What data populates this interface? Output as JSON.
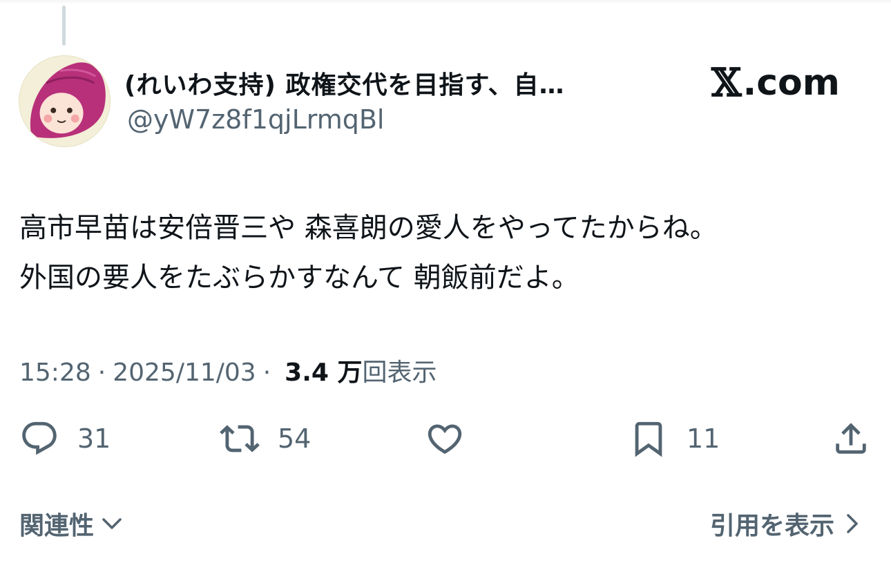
{
  "author": {
    "display_name": "(れいわ支持) 政権交代を目指す、自…",
    "handle": "@yW7z8f1qjLrmqBl"
  },
  "site_logo": {
    "mark": "𝕏",
    "text": ".com"
  },
  "tweet": {
    "lines": [
      "高市早苗は安倍晋三や 森喜朗の愛人をやってたからね。",
      "外国の要人をたぶらかすなんて 朝飯前だよ。"
    ]
  },
  "meta": {
    "time": "15:28",
    "separator": "·",
    "date": "2025/11/03",
    "views_count": "3.4 万",
    "views_label": "回表示"
  },
  "actions": {
    "reply": {
      "icon": "reply-icon",
      "count": "31"
    },
    "retweet": {
      "icon": "retweet-icon",
      "count": "54"
    },
    "like": {
      "icon": "heart-icon",
      "count": ""
    },
    "bookmark": {
      "icon": "bookmark-icon",
      "count": "11"
    },
    "share": {
      "icon": "share-icon",
      "count": ""
    }
  },
  "footer": {
    "related": "関連性",
    "quotes": "引用を表示"
  },
  "colors": {
    "text": "#0f1419",
    "secondary": "#536471",
    "thread_line": "#cfd9de",
    "avatar_hat": "#b8307a"
  }
}
